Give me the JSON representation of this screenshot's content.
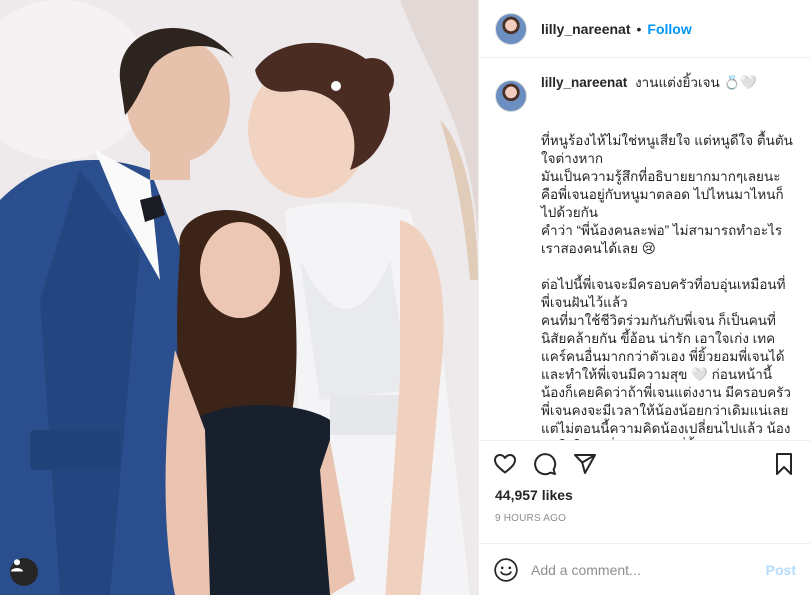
{
  "header": {
    "username": "lilly_nareenat",
    "separator": "•",
    "follow_label": "Follow"
  },
  "caption": {
    "username": "lilly_nareenat",
    "title": "งานแต่งยิ้วเจน 💍🤍",
    "text": "ที่หนูร้องไห้ไม่ใช่หนูเสียใจ แต่หนูดีใจ ตื้นตันใจต่างหาก\nมันเป็นความรู้สึกที่อธิบายยากมากๆเลยนะ คือพี่เจนอยู่กับหนูมาตลอด ไปไหนมาไหนก็ไปด้วยกัน\nคำว่า “พี่น้องคนละพ่อ” ไม่สามารถทำอะไรเราสองคนได้เลย 😢\n\nต่อไปนี้พี่เจนจะมีครอบครัวที่อบอุ่นเหมือนที่พี่เจนฝันไว้แล้ว\nคนที่มาใช้ชีวิตร่วมกันกับพี่เจน ก็เป็นคนที่นิสัยคล้ายกัน ขี้อ้อน น่ารัก เอาใจเก่ง เทคแคร์คนอื่นมากกว่าตัวเอง พี่ยิ้วยอมพี่เจนได้ และทำให้พี่เจนมีความสุข 🤍 ก่อนหน้านี้น้องก็เคยคิดว่าถ้าพี่เจนแต่งงาน มีครอบครัวพี่เจนคงจะมีเวลาให้น้องน้อยกว่าเดิมแน่เลย แต่ไม่ตอนนี้ความคิดน้องเปลี่ยนไปแล้ว น้องมันใจในตัวพี่เจนและตัวพี่ยิ้วมากๆ"
  },
  "actions": {
    "like_icon": "heart-icon",
    "comment_icon": "comment-icon",
    "share_icon": "paper-plane-icon",
    "save_icon": "bookmark-icon"
  },
  "likes": "44,957 likes",
  "timestamp": "9 HOURS AGO",
  "comment_input": {
    "placeholder": "Add a comment...",
    "post_label": "Post"
  },
  "colors": {
    "accent": "#0095f6",
    "post_disabled": "#b3dbff",
    "muted": "#8e8e8e",
    "text": "#262626"
  }
}
